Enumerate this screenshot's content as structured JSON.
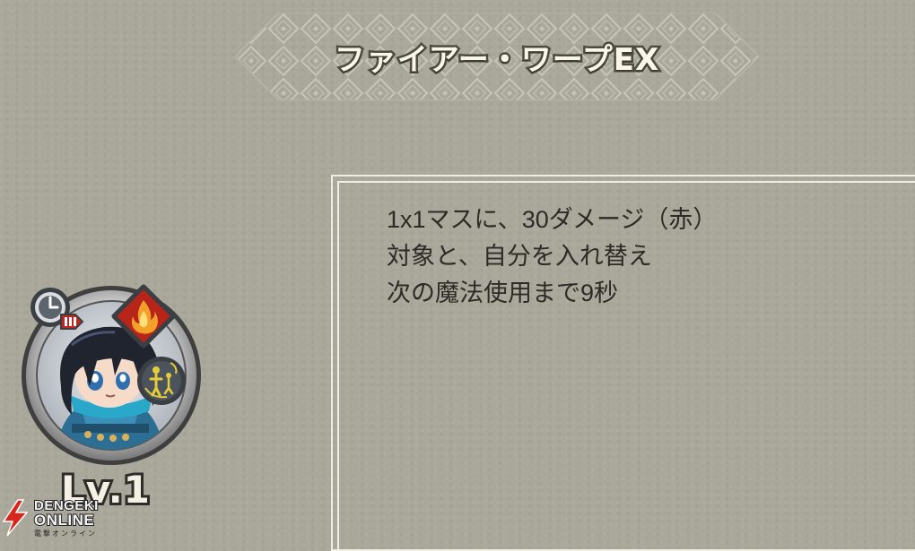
{
  "skill": {
    "name": "ファイアー・ワープEX",
    "description_lines": [
      "1x1マスに、30ダメージ（赤）",
      "対象と、自分を入れ替え",
      "次の魔法使用まで9秒"
    ]
  },
  "character": {
    "level_label": "Lv.1",
    "icons": [
      "cooldown-clock-icon",
      "fire-element-icon",
      "warp-swap-icon"
    ]
  },
  "watermark": {
    "line1": "DENGEKI",
    "line2": "ONLINE",
    "line3": "電撃オンライン"
  },
  "colors": {
    "background": "#a9a89b",
    "panel_border": "#efeee5",
    "fire_badge": "#c2281c",
    "warp_badge": "#e0c22a"
  }
}
